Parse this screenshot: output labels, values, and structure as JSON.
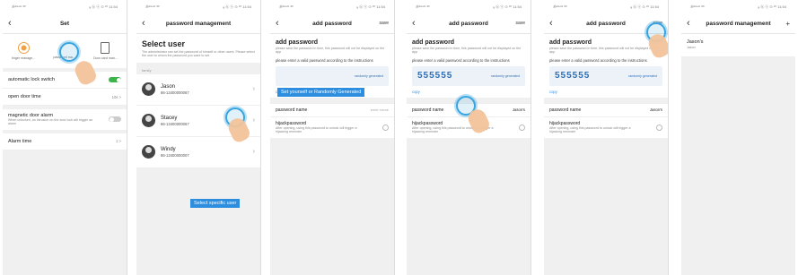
{
  "status": {
    "left": "ॐ⁵ᴳ⁴ᴳ ⁽ᴿ⁾",
    "right": "⁎ ⓑ ⓐ ⊙ ⁸⁰ 11:54"
  },
  "screen1": {
    "title": "Set",
    "icons": [
      "finger manage...",
      "password ma...",
      "Door card man..."
    ],
    "auto_lock_label": "automatic lock switch",
    "open_door_label": "open door time",
    "open_door_value": "10s >",
    "mag_label": "magnetic door alarm",
    "mag_desc": "When unlocked, an intrusion on the door lock will trigger an alarm",
    "alarm_label": "Alarm time",
    "alarm_value": "1 >"
  },
  "screen2": {
    "title": "password management",
    "heading": "Select user",
    "desc": "The administrator can set the password of himself or other users. Please select the user to whom the password you want to set.",
    "group_label": "family",
    "users": [
      {
        "name": "Jason",
        "phone": "86-13400000067"
      },
      {
        "name": "Stacey",
        "phone": "86-13400000067"
      },
      {
        "name": "Windy",
        "phone": "86-13400000007"
      }
    ],
    "banner": "Select specific user"
  },
  "screen3": {
    "title": "add password",
    "save": "save",
    "heading": "add password",
    "desc": "please save the password in time, this password will not be displayed on the app",
    "instr": "please enter a valid password according to the instructions",
    "gen": "randomly generated",
    "copy": "copy",
    "banner": "Set yourself or Randomly Generated",
    "pwd_name_label": "password name",
    "pwd_name_placeholder": "enter name",
    "hijack_label": "hijackpassword",
    "hijack_desc": "After opening, using this password to unlock will trigger a hijacking reminder"
  },
  "screen4": {
    "title": "add password",
    "save": "save",
    "heading": "add password",
    "desc": "please save the password in time, this password will not be displayed on the app",
    "instr": "please enter a valid password according to the instructions",
    "pwd": "555555",
    "gen": "randomly generated",
    "copy": "copy",
    "pwd_name_label": "password name",
    "pwd_name_value": "Jason's",
    "hijack_label": "hijackpassword",
    "hijack_desc": "After opening, using this password to unlock will trigger a hijacking reminder"
  },
  "screen5": {
    "title": "add password",
    "save": "save",
    "heading": "add password",
    "desc": "please save the password in time, this password will not be displayed on the app",
    "instr": "please enter a valid password according to the instructions",
    "pwd": "555555",
    "gen": "randomly generated",
    "copy": "copy",
    "pwd_name_label": "password name",
    "pwd_name_value": "Jason's",
    "hijack_label": "hijackpassword",
    "hijack_desc": "After opening, using this password to unlock will trigger a hijacking reminder"
  },
  "screen6": {
    "title": "password management",
    "add": "+",
    "entry_name": "Jason's",
    "entry_sub": "Jason"
  }
}
